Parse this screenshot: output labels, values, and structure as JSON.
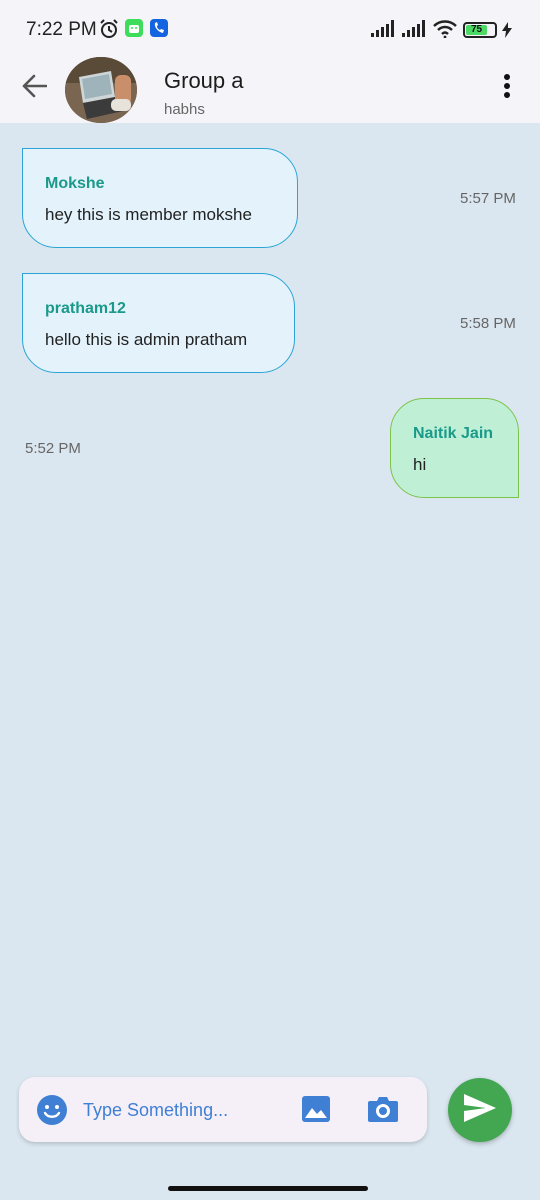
{
  "status_bar": {
    "time": "7:22 PM",
    "battery": "75",
    "icons": [
      "alarm-icon",
      "android-icon",
      "phone-app-icon",
      "signal-icon",
      "signal-icon",
      "wifi-icon",
      "battery-icon",
      "charging-icon"
    ]
  },
  "header": {
    "title": "Group a",
    "subtitle": "habhs"
  },
  "messages": [
    {
      "sender": "Mokshe",
      "text": "hey this is member mokshe",
      "time": "5:57 PM",
      "direction": "incoming"
    },
    {
      "sender": "pratham12",
      "text": "hello this is admin pratham",
      "time": "5:58 PM",
      "direction": "incoming"
    },
    {
      "sender": "Naitik Jain",
      "text": "hi",
      "time": "5:52 PM",
      "direction": "outgoing"
    }
  ],
  "composer": {
    "placeholder": "Type Something..."
  },
  "colors": {
    "chat_background": "#dbe7f0",
    "incoming_bubble": "#e3f2fb",
    "incoming_border": "#2aa5d6",
    "outgoing_bubble": "#bff0d6",
    "outgoing_border": "#7cc34a",
    "sender_name": "#1a9a8a",
    "accent_blue": "#3f7fd4",
    "send_button": "#43a752"
  }
}
